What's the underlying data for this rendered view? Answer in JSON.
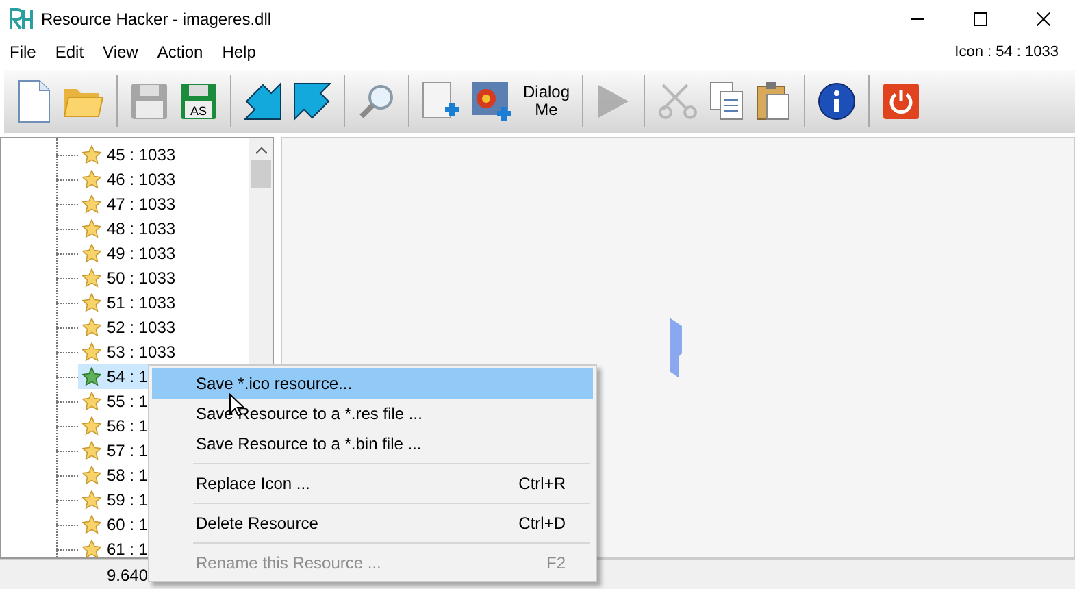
{
  "window": {
    "title": "Resource Hacker - imageres.dll"
  },
  "menu_bar": [
    "File",
    "Edit",
    "View",
    "Action",
    "Help"
  ],
  "resource_label": "Icon : 54 : 1033",
  "toolbar": [
    {
      "kind": "new",
      "disabled": false
    },
    {
      "kind": "open",
      "disabled": false
    },
    {
      "kind": "sep"
    },
    {
      "kind": "save",
      "disabled": true
    },
    {
      "kind": "saveas",
      "disabled": false,
      "badge": "AS"
    },
    {
      "kind": "sep"
    },
    {
      "kind": "arrow-in",
      "disabled": false
    },
    {
      "kind": "arrow-out",
      "disabled": false
    },
    {
      "kind": "sep"
    },
    {
      "kind": "search",
      "disabled": false
    },
    {
      "kind": "sep"
    },
    {
      "kind": "add-blank",
      "disabled": false
    },
    {
      "kind": "add-image",
      "disabled": false
    },
    {
      "kind": "dialog",
      "disabled": false,
      "line_1": "Dialog",
      "line_2": "Me"
    },
    {
      "kind": "sep"
    },
    {
      "kind": "play",
      "disabled": true
    },
    {
      "kind": "sep"
    },
    {
      "kind": "cut",
      "disabled": true
    },
    {
      "kind": "copy",
      "disabled": false
    },
    {
      "kind": "paste",
      "disabled": false
    },
    {
      "kind": "sep"
    },
    {
      "kind": "info",
      "disabled": false
    },
    {
      "kind": "sep"
    },
    {
      "kind": "exit",
      "disabled": false
    }
  ],
  "tree": [
    {
      "label": "45 : 1033",
      "selected": false
    },
    {
      "label": "46 : 1033",
      "selected": false
    },
    {
      "label": "47 : 1033",
      "selected": false
    },
    {
      "label": "48 : 1033",
      "selected": false
    },
    {
      "label": "49 : 1033",
      "selected": false
    },
    {
      "label": "50 : 1033",
      "selected": false
    },
    {
      "label": "51 : 1033",
      "selected": false
    },
    {
      "label": "52 : 1033",
      "selected": false
    },
    {
      "label": "53 : 1033",
      "selected": false
    },
    {
      "label": "54 : 1",
      "selected": true
    },
    {
      "label": "55 : 1",
      "selected": false
    },
    {
      "label": "56 : 1",
      "selected": false
    },
    {
      "label": "57 : 1",
      "selected": false
    },
    {
      "label": "58 : 1",
      "selected": false
    },
    {
      "label": "59 : 1",
      "selected": false
    },
    {
      "label": "60 : 1",
      "selected": false
    },
    {
      "label": "61 : 1",
      "selected": false
    }
  ],
  "status_bar": {
    "text": "9.640"
  },
  "context_menu": [
    {
      "kind": "item",
      "label": "Save *.ico resource...",
      "selected": true,
      "disabled": false
    },
    {
      "kind": "item",
      "label": "Save Resource to a *.res file ...",
      "selected": false,
      "disabled": false
    },
    {
      "kind": "item",
      "label": "Save Resource to a *.bin file ...",
      "selected": false,
      "disabled": false
    },
    {
      "kind": "separator"
    },
    {
      "kind": "item",
      "label": "Replace Icon ...",
      "shortcut": "Ctrl+R",
      "selected": false,
      "disabled": false
    },
    {
      "kind": "separator"
    },
    {
      "kind": "item",
      "label": "Delete Resource",
      "shortcut": "Ctrl+D",
      "selected": false,
      "disabled": false
    },
    {
      "kind": "separator"
    },
    {
      "kind": "item",
      "label": "Rename this Resource ...",
      "shortcut": "F2",
      "selected": false,
      "disabled": true
    }
  ]
}
